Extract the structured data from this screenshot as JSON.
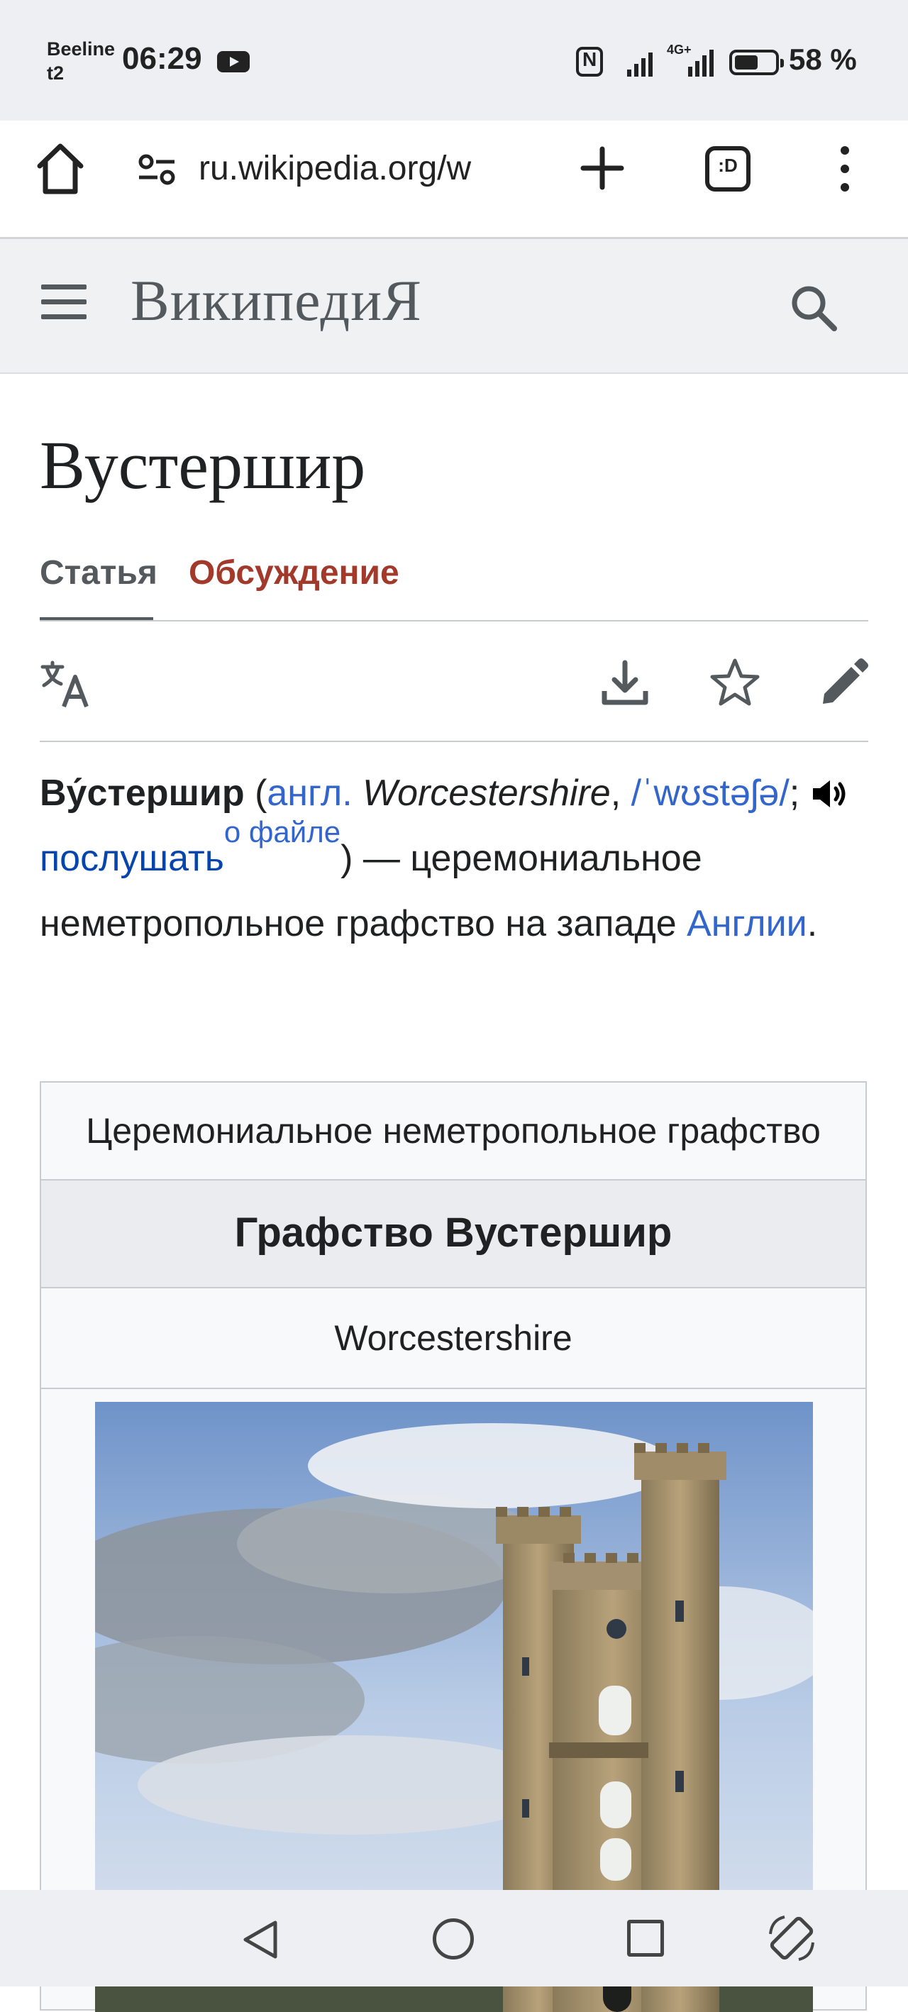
{
  "status_bar": {
    "carrier_line1": "Beeline",
    "carrier_line2": "t2",
    "time": "06:29",
    "network": "4G+",
    "battery": "58 %"
  },
  "browser": {
    "url": "ru.wikipedia.org/w",
    "tab_count_label": ":D"
  },
  "wiki_header": {
    "wordmark": "ВикипедиЯ"
  },
  "article": {
    "title": "Вустершир",
    "tabs": [
      {
        "label": "Статья",
        "active": true
      },
      {
        "label": "Обсуждение",
        "active": false
      }
    ],
    "lead": {
      "bold_name": "Ву́стершир",
      "open_paren": " (",
      "lang_link": "англ.",
      "english_name": " Worcestershire",
      "comma": ", ",
      "ipa": "/ˈwʊstəʃə/",
      "semicolon": "; ",
      "listen_link": "послушать",
      "file_sup": "о файле",
      "close_paren": ") — ",
      "text_main": "церемониальное неметропольное графство на западе ",
      "england_link": "Англии",
      "period": "."
    }
  },
  "infobox": {
    "type": "Церемониальное неметропольное графство",
    "name": "Графство Вустершир",
    "english_name": "Worcestershire"
  },
  "colors": {
    "link": "#3366cc",
    "talk_tab": "#a2392b",
    "text": "#202122"
  },
  "icons": [
    "home-icon",
    "site-settings-icon",
    "plus-icon",
    "tabs-icon",
    "more-vert-icon",
    "menu-icon",
    "search-icon",
    "translate-icon",
    "download-icon",
    "star-icon",
    "edit-icon",
    "speaker-icon",
    "back-icon",
    "home-circle-icon",
    "recents-icon",
    "rotate-icon"
  ]
}
